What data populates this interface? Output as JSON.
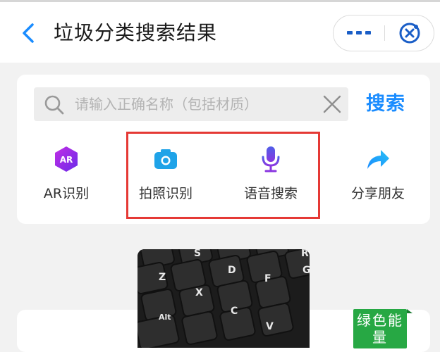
{
  "header": {
    "title": "垃圾分类搜索结果",
    "back_icon": "chevron-left-icon",
    "more_icon": "more-dots-icon",
    "close_icon": "circle-x-icon",
    "accent_color": "#1a8cff"
  },
  "search": {
    "placeholder": "请输入正确名称（包括材质）",
    "value": "",
    "button_label": "搜索",
    "search_icon": "magnifier-icon",
    "clear_icon": "clear-x-icon"
  },
  "actions": [
    {
      "label": "AR识别",
      "icon": "ar-icon",
      "icon_text": "AR",
      "color": "#8b2ae8"
    },
    {
      "label": "拍照识别",
      "icon": "camera-icon",
      "color": "#1fa3e8"
    },
    {
      "label": "语音搜索",
      "icon": "microphone-icon",
      "color": "#6b4de6"
    },
    {
      "label": "分享朋友",
      "icon": "share-arrow-icon",
      "color": "#1a8cff"
    }
  ],
  "result": {
    "badge_text": "绿色能量",
    "badge_color": "#27a844",
    "photo_icon": "keyboard-photo",
    "keycaps": [
      "S",
      "D",
      "F",
      "Z",
      "X",
      "C",
      "V",
      "Alt",
      "G",
      "R"
    ]
  }
}
